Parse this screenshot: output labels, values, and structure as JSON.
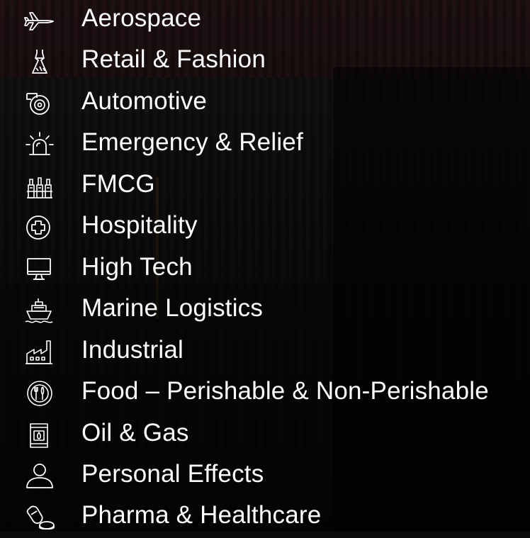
{
  "industries": [
    {
      "label": "Aerospace",
      "icon": "airplane-icon"
    },
    {
      "label": "Retail & Fashion",
      "icon": "dress-icon"
    },
    {
      "label": "Automotive",
      "icon": "turbo-icon"
    },
    {
      "label": "Emergency & Relief",
      "icon": "siren-icon"
    },
    {
      "label": "FMCG",
      "icon": "bottles-icon"
    },
    {
      "label": "Hospitality",
      "icon": "medical-cross-icon"
    },
    {
      "label": "High Tech",
      "icon": "monitor-icon"
    },
    {
      "label": "Marine Logistics",
      "icon": "ship-icon"
    },
    {
      "label": "Industrial",
      "icon": "factory-icon"
    },
    {
      "label": "Food – Perishable & Non-Perishable",
      "icon": "plate-cutlery-icon"
    },
    {
      "label": "Oil & Gas",
      "icon": "fuel-can-icon"
    },
    {
      "label": "Personal Effects",
      "icon": "person-icon"
    },
    {
      "label": "Pharma & Healthcare",
      "icon": "pills-icon"
    }
  ]
}
